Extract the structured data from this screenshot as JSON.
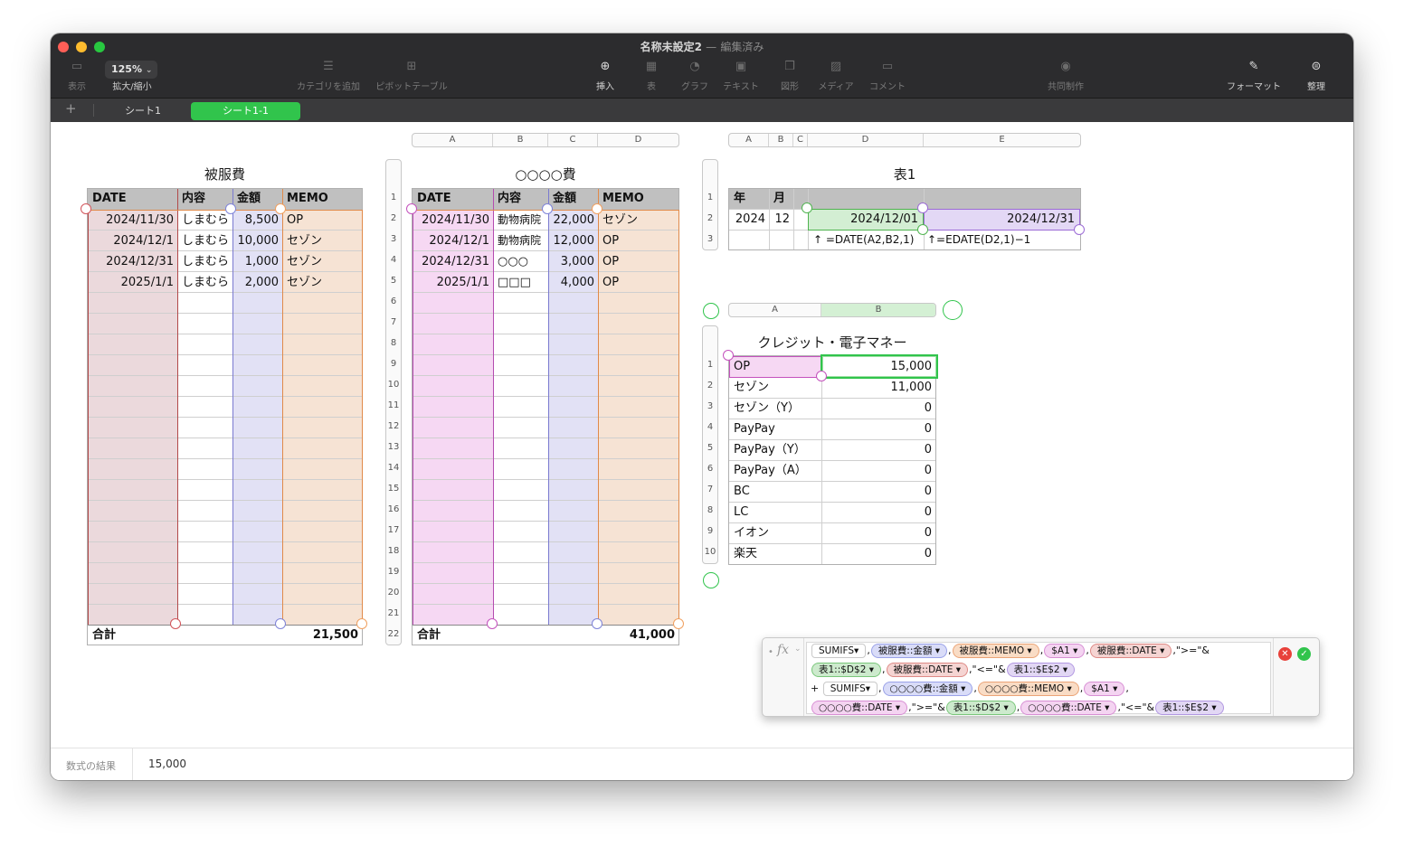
{
  "window": {
    "title": "名称未設定2",
    "title_separator": "—",
    "title_status": "編集済み",
    "zoom": "125%"
  },
  "toolbar": {
    "view": "表示",
    "zoom": "拡大/縮小",
    "add_category": "カテゴリを追加",
    "pivot": "ピボットテーブル",
    "insert": "挿入",
    "table": "表",
    "chart": "グラフ",
    "text": "テキスト",
    "shape": "図形",
    "media": "メディア",
    "comment": "コメント",
    "collaborate": "共同制作",
    "format": "フォーマット",
    "organize": "整理"
  },
  "sheets": {
    "add": "+",
    "tabs": [
      "シート1",
      "シート1-1"
    ],
    "active": 1
  },
  "t1": {
    "title": "被服費",
    "headers": [
      "DATE",
      "内容",
      "金額",
      "MEMO"
    ],
    "rows": [
      [
        "2024/11/30",
        "しまむら",
        "8,500",
        "OP"
      ],
      [
        "2024/12/1",
        "しまむら",
        "10,000",
        "セゾン"
      ],
      [
        "2024/12/31",
        "しまむら",
        "1,000",
        "セゾン"
      ],
      [
        "2025/1/1",
        "しまむら",
        "2,000",
        "セゾン"
      ]
    ],
    "footer_label": "合計",
    "footer_total": "21,500"
  },
  "t2": {
    "title": "○○○○費",
    "col_letters": [
      "A",
      "B",
      "C",
      "D"
    ],
    "row_numbers": [
      "1",
      "2",
      "3",
      "4",
      "5",
      "6",
      "7",
      "8",
      "9",
      "10",
      "11",
      "12",
      "13",
      "14",
      "15",
      "16",
      "17",
      "18",
      "19",
      "20",
      "21",
      "22"
    ],
    "headers": [
      "DATE",
      "内容",
      "金額",
      "MEMO"
    ],
    "rows": [
      [
        "2024/11/30",
        "動物病院",
        "22,000",
        "セゾン"
      ],
      [
        "2024/12/1",
        "動物病院",
        "12,000",
        "OP"
      ],
      [
        "2024/12/31",
        "○○○",
        "3,000",
        "OP"
      ],
      [
        "2025/1/1",
        "□□□",
        "4,000",
        "OP"
      ]
    ],
    "footer_label": "合計",
    "footer_total": "41,000"
  },
  "t3": {
    "title": "表1",
    "col_letters": [
      "A",
      "B",
      "C",
      "D",
      "E"
    ],
    "row_numbers": [
      "1",
      "2",
      "3"
    ],
    "headers": [
      "年",
      "月"
    ],
    "year": "2024",
    "month": "12",
    "start": "2024/12/01",
    "end": "2024/12/31",
    "note_d": "↑ =DATE(A2,B2,1)",
    "note_e": "↑=EDATE(D2,1)−1"
  },
  "t4": {
    "title": "クレジット・電子マネー",
    "col_letters": [
      "A",
      "B"
    ],
    "row_numbers": [
      "1",
      "2",
      "3",
      "4",
      "5",
      "6",
      "7",
      "8",
      "9",
      "10"
    ],
    "rows": [
      [
        "OP",
        "15,000"
      ],
      [
        "セゾン",
        "11,000"
      ],
      [
        "セゾン（Y）",
        "0"
      ],
      [
        "PayPay",
        "0"
      ],
      [
        "PayPay（Y）",
        "0"
      ],
      [
        "PayPay（A）",
        "0"
      ],
      [
        "BC",
        "0"
      ],
      [
        "LC",
        "0"
      ],
      [
        "イオン",
        "0"
      ],
      [
        "楽天",
        "0"
      ]
    ]
  },
  "formula": {
    "fx": "fx",
    "sumifs": "SUMIFS",
    "t_kingaku1": "被服費::金額",
    "t_memo1": "被服費::MEMO",
    "t_a1": "$A1",
    "t_date1": "被服費::DATE",
    "s_ge": ",\">=\"&",
    "t_d2": "表1::$D$2",
    "s_le": ",\"<=\"&",
    "t_e2": "表1::$E$2",
    "plus": "+",
    "t_kingaku2": "○○○○費::金額",
    "t_memo2": "○○○○費::MEMO",
    "t_date2": "○○○○費::DATE"
  },
  "status": {
    "label": "数式の結果",
    "value": "15,000"
  },
  "colors": {
    "accent": "#31c44c",
    "close": "#ff5f57",
    "minimize": "#febc2e",
    "zoom": "#28c840"
  }
}
